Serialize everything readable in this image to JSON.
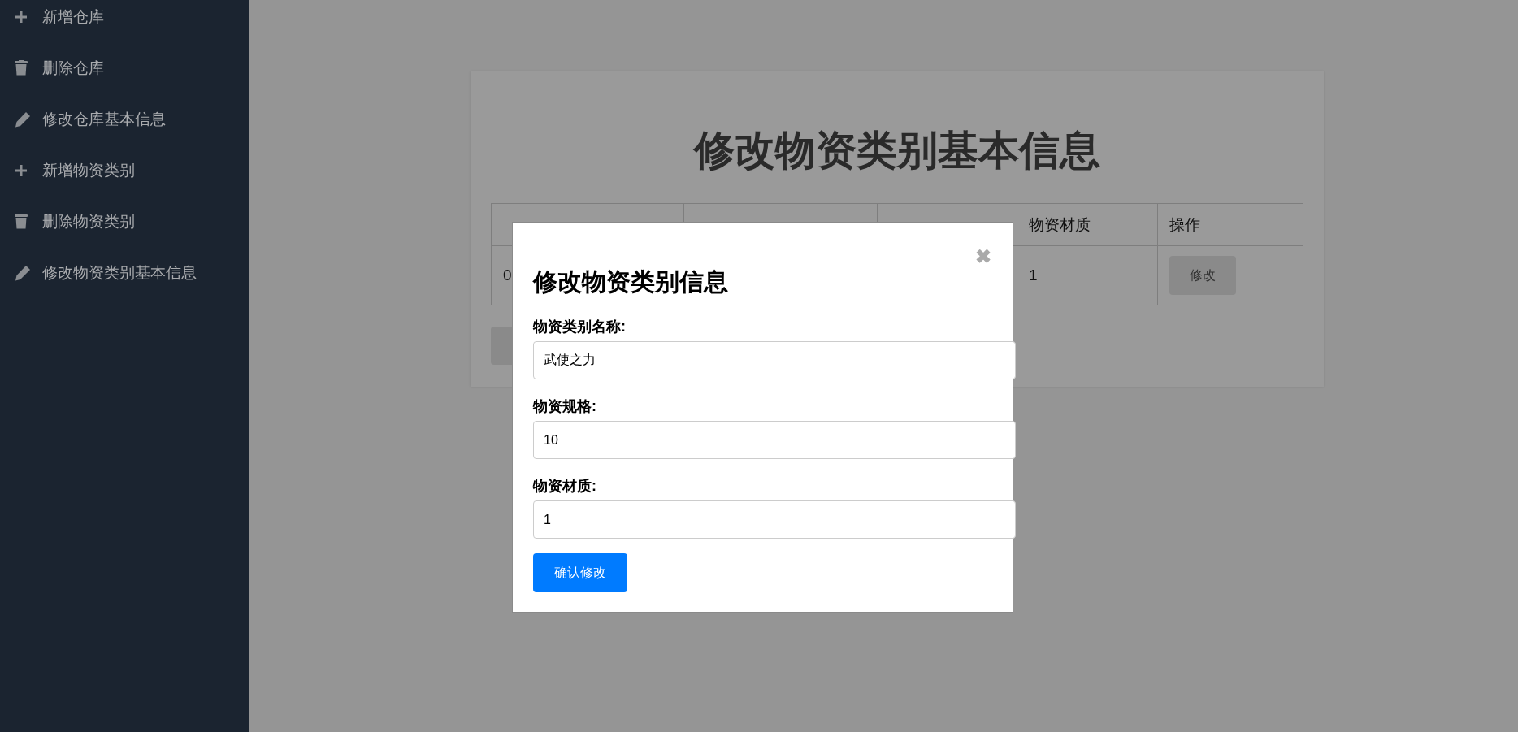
{
  "sidebar": {
    "items": [
      {
        "kind": "add",
        "label": "新增仓库"
      },
      {
        "kind": "delete",
        "label": "删除仓库"
      },
      {
        "kind": "edit",
        "label": "修改仓库基本信息"
      },
      {
        "kind": "add",
        "label": "新增物资类别"
      },
      {
        "kind": "delete",
        "label": "删除物资类别"
      },
      {
        "kind": "edit",
        "label": "修改物资类别基本信息"
      }
    ]
  },
  "page": {
    "title": "修改物资类别基本信息",
    "table": {
      "columns": [
        null,
        null,
        null,
        "物资材质",
        "操作"
      ],
      "rows": [
        {
          "cells": [
            "0",
            null,
            null,
            "1"
          ],
          "action": "修改"
        }
      ]
    }
  },
  "modal": {
    "title": "修改物资类别信息",
    "close": "✖",
    "fields": [
      {
        "label": "物资类别名称:",
        "value": "武使之力"
      },
      {
        "label": "物资规格:",
        "value": "10"
      },
      {
        "label": "物资材质:",
        "value": "1"
      }
    ],
    "submit": "确认修改"
  }
}
